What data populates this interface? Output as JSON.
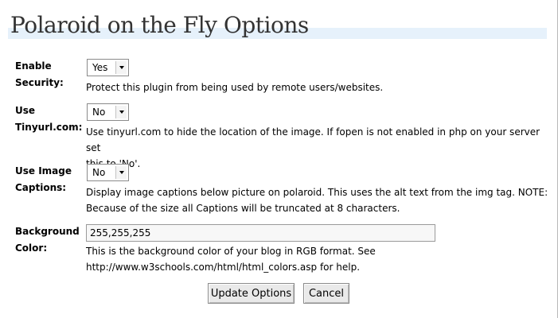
{
  "page": {
    "title": "Polaroid on the Fly Options"
  },
  "options": [
    {
      "label_line1": "Enable",
      "label_line2": "Security:",
      "value": "Yes",
      "description": "Protect this plugin from being used by remote users/websites."
    },
    {
      "label_line1": "Use",
      "label_line2": "Tinyurl.com:",
      "value": "No",
      "description_line1": "Use tinyurl.com to hide the location of the image. If fopen is not enabled in php on your server set",
      "description_line2": "this to 'No'."
    },
    {
      "label_line1": "Use Image",
      "label_line2": "Captions:",
      "value": "No",
      "description_line1": "Display image captions below picture on polaroid. This uses the alt text from the img tag. NOTE:",
      "description_line2": "Because of the size all Captions will be truncated at 8 characters."
    },
    {
      "label_line1": "Background",
      "label_line2": "Color:",
      "value": "255,255,255",
      "description_line1": "This is the background color of your blog in RGB format. See",
      "description_line2": "http://www.w3schools.com/html/html_colors.asp for help."
    }
  ],
  "buttons": {
    "update": "Update Options",
    "cancel": "Cancel"
  },
  "colors": {
    "title_bar": "#e6f1fb",
    "title_text": "#333333"
  }
}
